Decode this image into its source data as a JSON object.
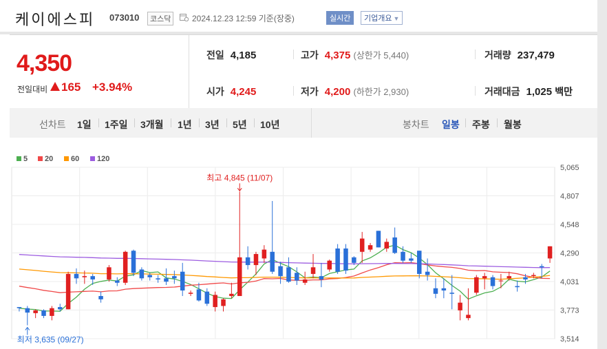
{
  "header": {
    "company_name": "케이에스피",
    "code": "073010",
    "market": "코스닥",
    "datetime": "2024.12.23 12:59 기준(장중)",
    "realtime_label": "실시간",
    "overview_label": "기업개요"
  },
  "quote": {
    "price": "4,350",
    "change_label": "전일대비",
    "change": "165",
    "change_pct": "+3.94%",
    "prev_close_label": "전일",
    "prev_close": "4,185",
    "high_label": "고가",
    "high": "4,375",
    "upper_limit_label": "(상한가 5,440)",
    "volume_label": "거래량",
    "volume": "237,479",
    "open_label": "시가",
    "open": "4,245",
    "low_label": "저가",
    "low": "4,200",
    "lower_limit_label": "(하한가 2,930)",
    "amount_label": "거래대금",
    "amount": "1,025",
    "amount_unit": "백만",
    "up_color": "#e01a1a"
  },
  "period_bar": {
    "line_chart_label": "선차트",
    "line_periods": [
      "1일",
      "1주일",
      "3개월",
      "1년",
      "3년",
      "5년",
      "10년"
    ],
    "candle_chart_label": "봉차트",
    "candle_periods": [
      "일봉",
      "주봉",
      "월봉"
    ],
    "active_candle_period": "일봉"
  },
  "chart_data": {
    "type": "candlestick",
    "legend": [
      {
        "name": "5",
        "color": "#4caf50"
      },
      {
        "name": "20",
        "color": "#f04848"
      },
      {
        "name": "60",
        "color": "#ff9800"
      },
      {
        "name": "120",
        "color": "#9c5ce0"
      }
    ],
    "y_ticks": [
      "5,065",
      "4,807",
      "4,548",
      "4,290",
      "4,031",
      "3,773",
      "3,514"
    ],
    "ylim": [
      3514,
      5065
    ],
    "up_color": "#e02020",
    "down_color": "#2a70d8",
    "high_annotation": "최고 4,845 (11/07)",
    "high_value": 4845,
    "high_index": 27,
    "low_annotation": "최저 3,635 (09/27)",
    "low_value": 3635,
    "low_index": 1,
    "candles": [
      [
        3800,
        3800,
        3760,
        3790
      ],
      [
        3790,
        3810,
        3635,
        3750
      ],
      [
        3745,
        3780,
        3700,
        3770
      ],
      [
        3770,
        3780,
        3700,
        3720
      ],
      [
        3720,
        3810,
        3680,
        3790
      ],
      [
        3800,
        3830,
        3760,
        3780
      ],
      [
        3780,
        4120,
        3780,
        4100
      ],
      [
        4100,
        4150,
        4010,
        4060
      ],
      [
        4070,
        4130,
        4010,
        4080
      ],
      [
        4080,
        4100,
        4000,
        4050
      ],
      [
        3900,
        3940,
        3840,
        3870
      ],
      [
        4050,
        4180,
        4030,
        4160
      ],
      [
        4040,
        4070,
        3990,
        4020
      ],
      [
        4020,
        4310,
        4000,
        4300
      ],
      [
        4310,
        4320,
        4080,
        4110
      ],
      [
        4140,
        4160,
        4040,
        4060
      ],
      [
        4090,
        4110,
        4040,
        4070
      ],
      [
        4060,
        4090,
        4020,
        4050
      ],
      [
        4060,
        4150,
        4000,
        4030
      ],
      [
        4080,
        4130,
        4010,
        4060
      ],
      [
        4120,
        4200,
        3900,
        3950
      ],
      [
        3920,
        3950,
        3900,
        3930
      ],
      [
        3960,
        4020,
        3850,
        3860
      ],
      [
        3940,
        3970,
        3810,
        3830
      ],
      [
        3800,
        3940,
        3760,
        3910
      ],
      [
        3810,
        3880,
        3760,
        3870
      ],
      [
        3900,
        4020,
        3880,
        3920
      ],
      [
        3900,
        4845,
        3900,
        4250
      ],
      [
        4250,
        4350,
        4140,
        4180
      ],
      [
        4180,
        4300,
        4090,
        4280
      ],
      [
        4240,
        4360,
        4200,
        4320
      ],
      [
        4300,
        4760,
        4100,
        4120
      ],
      [
        4170,
        4210,
        4010,
        4080
      ],
      [
        4160,
        4250,
        4020,
        4030
      ],
      [
        4110,
        4160,
        4000,
        4040
      ],
      [
        4020,
        4120,
        4000,
        4050
      ],
      [
        4100,
        4280,
        4060,
        4160
      ],
      [
        4080,
        4200,
        3980,
        4050
      ],
      [
        4140,
        4230,
        4120,
        4220
      ],
      [
        4330,
        4370,
        4100,
        4120
      ],
      [
        4330,
        4370,
        4100,
        4130
      ],
      [
        4250,
        4260,
        4180,
        4200
      ],
      [
        4300,
        4480,
        4200,
        4420
      ],
      [
        4320,
        4380,
        4300,
        4360
      ],
      [
        4490,
        4350,
        4500,
        4340
      ],
      [
        4330,
        4420,
        4300,
        4390
      ],
      [
        4430,
        4520,
        4280,
        4290
      ],
      [
        4300,
        4350,
        4200,
        4220
      ],
      [
        4240,
        4290,
        4200,
        4220
      ],
      [
        4310,
        4230,
        4060,
        4100
      ],
      [
        4120,
        4240,
        4040,
        4090
      ],
      [
        3970,
        4060,
        3880,
        3920
      ],
      [
        3970,
        4060,
        3880,
        3950
      ],
      [
        3930,
        4090,
        3780,
        3920
      ],
      [
        3770,
        3910,
        3680,
        3840
      ],
      [
        3700,
        3970,
        3680,
        3730
      ],
      [
        3930,
        4090,
        3910,
        4070
      ],
      [
        4060,
        4110,
        3960,
        4080
      ],
      [
        4070,
        4090,
        3960,
        3990
      ],
      [
        4040,
        4100,
        3970,
        4040
      ],
      [
        4060,
        4120,
        4040,
        4080
      ],
      [
        3990,
        4040,
        3940,
        3980
      ],
      [
        4070,
        4100,
        4010,
        4050
      ],
      [
        4080,
        4110,
        4060,
        4090
      ],
      [
        4170,
        4190,
        4060,
        4160
      ],
      [
        4240,
        4350,
        4200,
        4350
      ]
    ]
  }
}
